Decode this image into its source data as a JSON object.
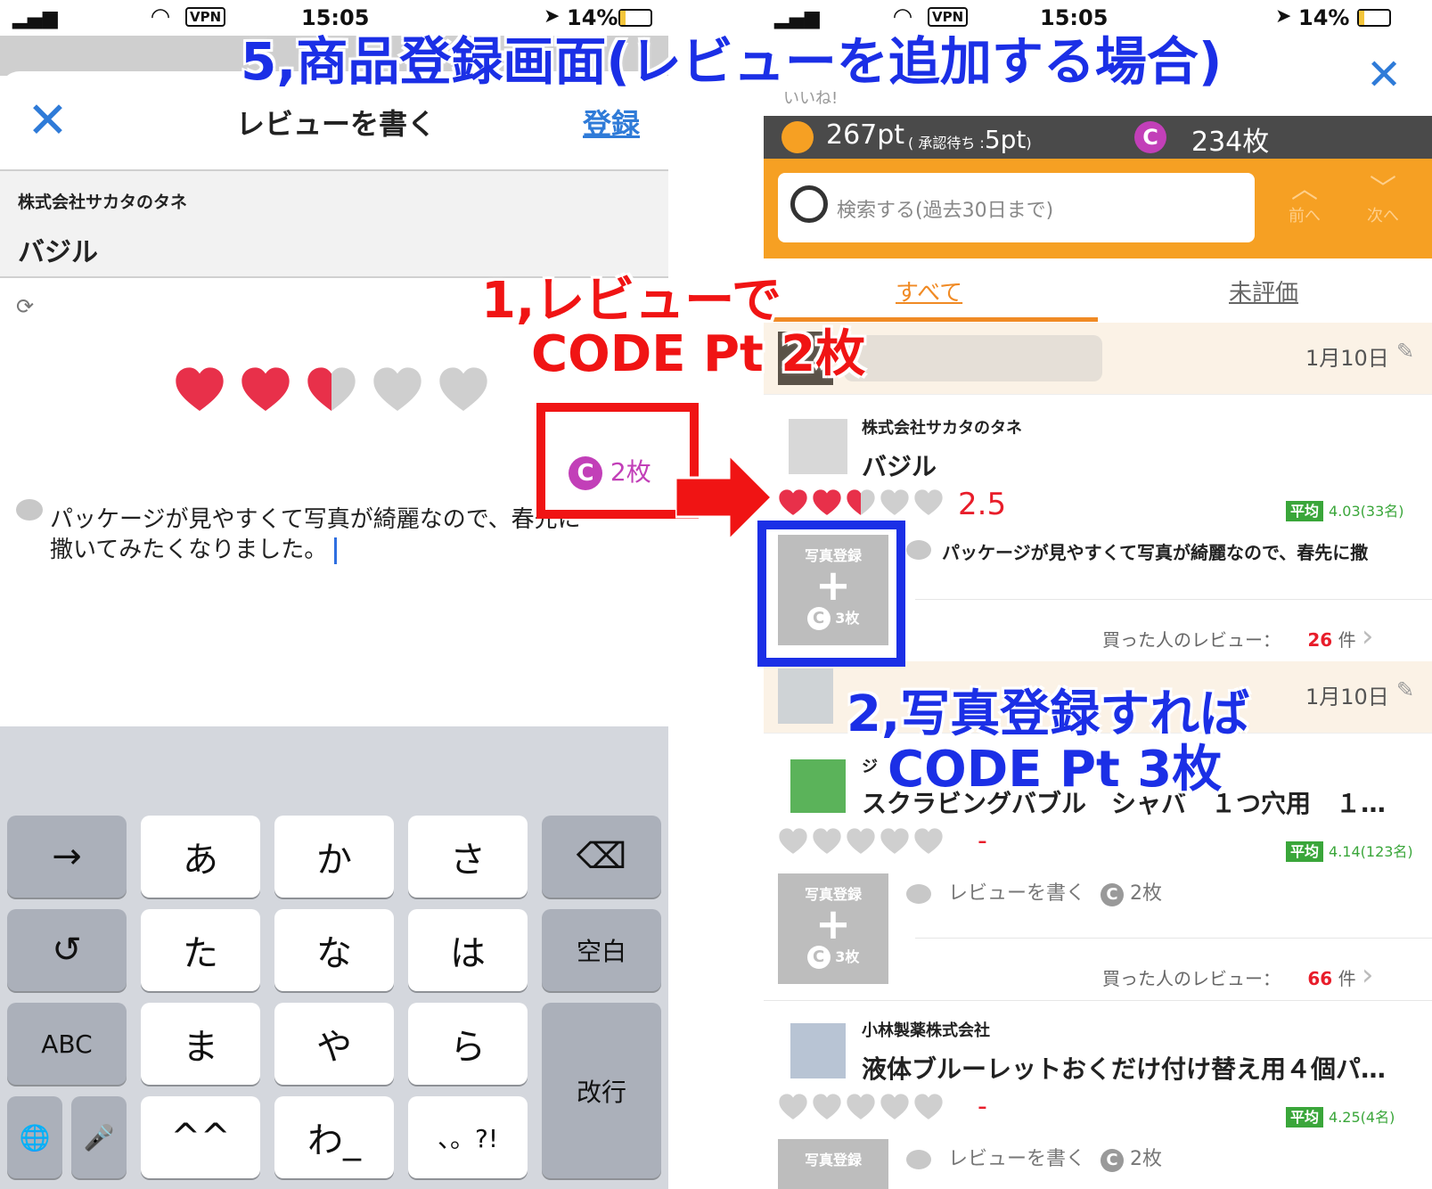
{
  "overlay": {
    "title": "5,商品登録画面(レビューを追加する場合)",
    "step1_line1": "1,レビューで",
    "step1_line2": "CODE Pt 2枚",
    "step1_badge": "2枚",
    "step2_line1": "2,写真登録すれば",
    "step2_line2": "CODE Pt 3枚"
  },
  "left": {
    "status": {
      "time": "15:05",
      "vpn": "VPN",
      "battery": "14%"
    },
    "header": {
      "title": "レビューを書く",
      "register": "登録"
    },
    "product": {
      "maker": "株式会社サカタのタネ",
      "name": "バジル"
    },
    "rating": {
      "value": 2.5
    },
    "review_text_1": "パッケージが見やすくて写真が綺麗なので、春先に",
    "review_text_2": "撒いてみたくなりました。",
    "keyboard": {
      "row1": [
        "→",
        "あ",
        "か",
        "さ",
        "⌫"
      ],
      "row2": [
        "↺",
        "た",
        "な",
        "は",
        "空白"
      ],
      "row3": [
        "ABC",
        "ま",
        "や",
        "ら"
      ],
      "row4": [
        "🌐",
        "🎤",
        "^^",
        "わ_",
        "、。?!"
      ],
      "enter": "改行"
    }
  },
  "right": {
    "status": {
      "time": "15:05",
      "vpn": "VPN",
      "battery": "14%"
    },
    "like_label": "いいね!",
    "points": {
      "pt": "267pt",
      "pending_prefix": "( 承認待ち :",
      "pending_value": "5pt",
      "pending_suffix": ")",
      "coins": "234枚"
    },
    "search": {
      "placeholder": "検索する(過去30日まで)",
      "prev": "前へ",
      "next": "次へ"
    },
    "tabs": {
      "all": "すべて",
      "unrated": "未評価"
    },
    "date": "1月10日",
    "colors": {
      "orange": "#f6a023",
      "bar": "#4a4a4a",
      "green": "#3aa63a",
      "red": "#e81d2a",
      "accent_tab": "#f08a24",
      "coin": "#c23fb8"
    },
    "photo_button": {
      "label": "写真登録",
      "coins": "3枚"
    },
    "avg_label": "平均",
    "buyers_label": "買った人のレビュー：",
    "count_unit": "件",
    "write_review": "レビューを書く",
    "write_review_coins": "2枚",
    "items": [
      {
        "maker": "株式会社サカタのタネ",
        "name": "バジル",
        "score": "2.5",
        "rating": 2.5,
        "avg": "4.03(33名)",
        "review": "パッケージが見やすくて写真が綺麗なので、春先に撒",
        "buyers": "26"
      },
      {
        "maker": "ジ",
        "name": "スクラビングバブル　シャバ　１つ穴用　１…",
        "score": "-",
        "rating": 0,
        "avg": "4.14(123名)",
        "buyers": "66"
      },
      {
        "maker": "小林製薬株式会社",
        "name": "液体ブルーレットおくだけ付け替え用４個パ…",
        "score": "-",
        "rating": 0,
        "avg": "4.25(4名)"
      }
    ]
  }
}
